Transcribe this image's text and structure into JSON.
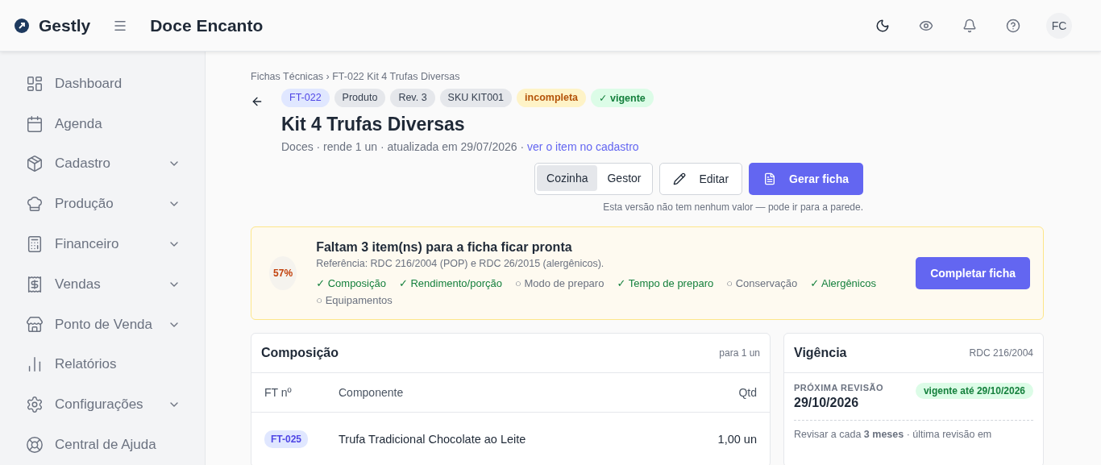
{
  "app": {
    "name": "Gestly",
    "company": "Doce Encanto",
    "avatar": "FC"
  },
  "sidebar": {
    "items": [
      {
        "label": "Dashboard",
        "expandable": false
      },
      {
        "label": "Agenda",
        "expandable": false
      },
      {
        "label": "Cadastro",
        "expandable": true
      },
      {
        "label": "Produção",
        "expandable": true
      },
      {
        "label": "Financeiro",
        "expandable": true
      },
      {
        "label": "Vendas",
        "expandable": true
      },
      {
        "label": "Ponto de Venda",
        "expandable": true
      },
      {
        "label": "Relatórios",
        "expandable": false
      },
      {
        "label": "Configurações",
        "expandable": true
      },
      {
        "label": "Central de Ajuda",
        "expandable": false
      }
    ]
  },
  "breadcrumb": "Fichas Técnicas › FT-022 Kit 4 Trufas Diversas",
  "badges": [
    {
      "label": "FT-022",
      "kind": "code"
    },
    {
      "label": "Produto",
      "kind": "neutral"
    },
    {
      "label": "Rev. 3",
      "kind": "neutral"
    },
    {
      "label": "SKU KIT001",
      "kind": "neutral"
    },
    {
      "label": "incompleta",
      "kind": "warning"
    },
    {
      "label": "✓ vigente",
      "kind": "success"
    }
  ],
  "title": "Kit 4 Trufas Diversas",
  "subtitle": "Doces · rende 1 un · atualizada em 29/07/2026 ·",
  "subtitle_link": "ver o item no cadastro",
  "view_toggle": [
    {
      "label": "Cozinha",
      "selected": true
    },
    {
      "label": "Gestor",
      "selected": false
    }
  ],
  "edit_button": "Editar",
  "generate_button": "Gerar ficha",
  "version_note": "Esta versão não tem nenhum valor — pode ir para a parede.",
  "readiness": {
    "percent": "57%",
    "title": "Faltam 3 item(ns) para a ficha ficar pronta",
    "reference": "Referência: RDC 216/2004 (POP) e RDC 26/2015 (alergênicos).",
    "button": "Completar ficha",
    "checklist": [
      {
        "label": "✓ Composição",
        "done": true
      },
      {
        "label": "✓ Rendimento/porção",
        "done": true
      },
      {
        "label": "○ Modo de preparo",
        "done": false
      },
      {
        "label": "✓ Tempo de preparo",
        "done": true
      },
      {
        "label": "○ Conservação",
        "done": false
      },
      {
        "label": "✓ Alergênicos",
        "done": true
      },
      {
        "label": "○ Equipamentos",
        "done": false
      }
    ]
  },
  "composition": {
    "title": "Composição",
    "note": "para 1 un",
    "columns": [
      "FT nº",
      "Componente",
      "Qtd"
    ],
    "rows": [
      {
        "code": "FT-025",
        "component": "Trufa Tradicional Chocolate ao Leite",
        "qty": "1,00 un"
      }
    ]
  },
  "validity": {
    "title": "Vigência",
    "note": "RDC 216/2004",
    "label": "PRÓXIMA REVISÃO",
    "date": "29/10/2026",
    "badge": "vigente até 29/10/2026",
    "text": "Revisar a cada **3 meses** · última revisão em"
  }
}
